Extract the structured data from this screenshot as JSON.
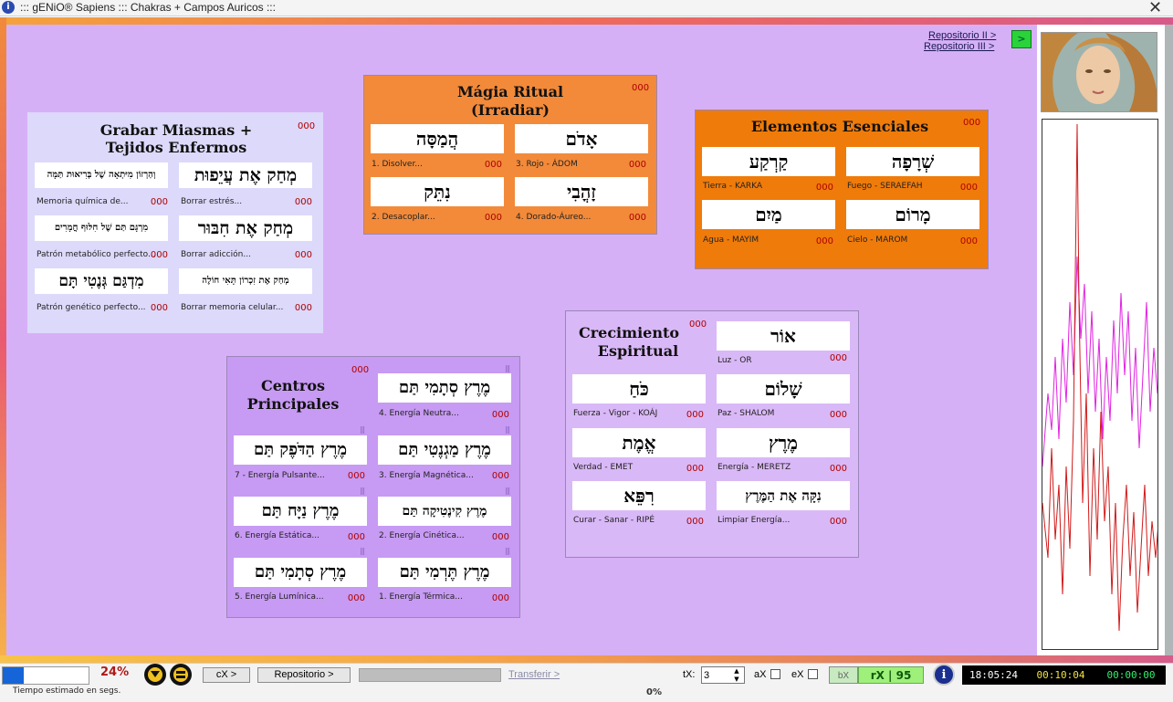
{
  "window": {
    "title": "::: gENiO® Sapiens ::: Chakras + Campos Auricos :::"
  },
  "top_links": {
    "repo2": "Repositorio II >",
    "repo3": "Repositorio III >",
    "go": ">"
  },
  "panels": {
    "grabar": {
      "title1": "Grabar Miasmas +",
      "title2": "Tejidos Enfermos",
      "count": "000",
      "items": [
        {
          "hebrew": "וְהַרְזוֹן מִיּתְאָה שֶׁל בְּרִיאוּת תַּמָּה",
          "label": "Memoria química de...",
          "count": "000"
        },
        {
          "hebrew": "מְחַק אֶת עֲיֵפוּת",
          "label": "Borrar estrés...",
          "count": "000"
        },
        {
          "hebrew": "מִרְגָּם תַּם שֶׁל חִלּוּף חֳמָרִים",
          "label": "Patrón metabólico perfecto...",
          "count": "000"
        },
        {
          "hebrew": "מְחַק אֶת חִבּוּר",
          "label": "Borrar adicción...",
          "count": "000"
        },
        {
          "hebrew": "מִדְגַּם גְּנֶטִי תָּם",
          "label": "Patrón genético perfecto...",
          "count": "000"
        },
        {
          "hebrew": "מְחַק אֶת זִכְרוֹן תָּאִי חוֹלֶה",
          "label": "Borrar memoria celular...",
          "count": "000"
        }
      ]
    },
    "magia": {
      "title1": "Mágia Ritual",
      "title2": "(Irradiar)",
      "count": "000",
      "items": [
        {
          "hebrew": "הֲמַסָּה",
          "label": "1. Disolver...",
          "count": "000"
        },
        {
          "hebrew": "אָדֹם",
          "label": "3. Rojo - ÁDOM",
          "count": "000"
        },
        {
          "hebrew": "נִתֵּק",
          "label": "2. Desacoplar...",
          "count": "000"
        },
        {
          "hebrew": "זָהֳבִי",
          "label": "4. Dorado-Áureo...",
          "count": "000"
        }
      ]
    },
    "elementos": {
      "title": "Elementos Esenciales",
      "count": "000",
      "items": [
        {
          "hebrew": "קַרְקַע",
          "label": "Tierra - KARKA",
          "count": "000"
        },
        {
          "hebrew": "שְׁרָפָה",
          "label": "Fuego - SERAEFAH",
          "count": "000"
        },
        {
          "hebrew": "מַיִם",
          "label": "Agua - MAYIM",
          "count": "000"
        },
        {
          "hebrew": "מָרוֹם",
          "label": "Cielo - MAROM",
          "count": "000"
        }
      ]
    },
    "centros": {
      "title1": "Centros",
      "title2": "Principales",
      "count": "000",
      "bars": "|||",
      "items": [
        {
          "hebrew": "מֶרֶץ סְתָמִי תַּם",
          "label": "4. Energía Neutra...",
          "count": "000"
        },
        {
          "hebrew": "מֶרֶץ הַדֹּפֶק תַּם",
          "label": "7 - Energía Pulsante...",
          "count": "000"
        },
        {
          "hebrew": "מֶרֶץ מַגְנֶטִי תַּם",
          "label": "3. Energía Magnética...",
          "count": "000"
        },
        {
          "hebrew": "מֶרֶץ נַיָּח תַּם",
          "label": "6. Energía Estática...",
          "count": "000"
        },
        {
          "hebrew": "מֶרֶץ קִינֶטִיקָה תַּם",
          "label": "2. Energía Cinética...",
          "count": "000"
        },
        {
          "hebrew": "מֶרֶץ סְתָמִי תַּם",
          "label": "5. Energía Lumínica...",
          "count": "000"
        },
        {
          "hebrew": "מֶרֶץ תֶּרְמִי תַּם",
          "label": "1. Energía Térmica...",
          "count": "000"
        }
      ]
    },
    "crecimiento": {
      "title1": "Crecimiento",
      "title2": "Espiritual",
      "count": "000",
      "items": [
        {
          "hebrew": "אוֹר",
          "label": "Luz - OR",
          "count": "000"
        },
        {
          "hebrew": "כֹּחַ",
          "label": "Fuerza - Vigor - KOÁJ",
          "count": "000"
        },
        {
          "hebrew": "שָׁלוֹם",
          "label": "Paz - SHALOM",
          "count": "000"
        },
        {
          "hebrew": "אֱמֶת",
          "label": "Verdad - EMET",
          "count": "000"
        },
        {
          "hebrew": "מֶרֶץ",
          "label": "Energía - MERETZ",
          "count": "000"
        },
        {
          "hebrew": "רִפֵּא",
          "label": "Curar - Sanar - RIPÉ",
          "count": "000"
        },
        {
          "hebrew": "נִקָּה אֶת הַמֶּרֶץ",
          "label": "Limpiar Energía...",
          "count": "000"
        }
      ]
    }
  },
  "bottom": {
    "percent": "24%",
    "estimate": "Tiempo estimado en segs.",
    "cx": "cX >",
    "repositorio": "Repositorio >",
    "transferir": "Transferir >",
    "progress_text": "0%",
    "tx_label": "tX:",
    "tx_value": "3",
    "ax": "aX",
    "ex": "eX",
    "bx": "bX",
    "rx": "rX | 95",
    "clock1": "18:05:24",
    "clock2": "00:10:04",
    "clock3": "00:00:00",
    "progress": 0.24
  },
  "colors": {
    "panel_grabar": "#dcd9fb",
    "panel_magia": "#f28a3a",
    "panel_elementos": "#ef7b0a",
    "panel_centros": "#c79af3",
    "panel_crecimiento": "#d9b8f7",
    "count_red": "#b00000",
    "clock_white": "#ffffff",
    "clock_yellow": "#f2e23a",
    "clock_green": "#2cf26a"
  },
  "icons": [
    "info-icon",
    "close-icon",
    "chevron-down-icon",
    "equals-icon",
    "spin-up-icon",
    "spin-down-icon"
  ]
}
